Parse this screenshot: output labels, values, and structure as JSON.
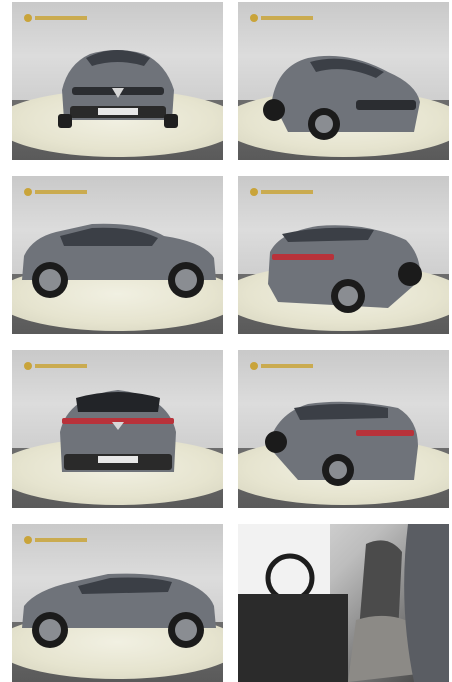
{
  "gallery": {
    "photos": [
      {
        "view": "front",
        "kind": "exterior"
      },
      {
        "view": "front-three-quarter-right",
        "kind": "exterior"
      },
      {
        "view": "side-left",
        "kind": "exterior"
      },
      {
        "view": "rear-three-quarter-left",
        "kind": "exterior"
      },
      {
        "view": "rear",
        "kind": "exterior"
      },
      {
        "view": "rear-three-quarter-right",
        "kind": "exterior"
      },
      {
        "view": "side-left-alt",
        "kind": "exterior"
      },
      {
        "view": "interior-front-seats",
        "kind": "interior"
      }
    ],
    "colors": {
      "car_body": "#6f737a",
      "turntable": "#ecebd8",
      "wall": "#d3d3d3",
      "floor": "#5f5f5f",
      "dealer_logo": "#c9a43a"
    }
  }
}
